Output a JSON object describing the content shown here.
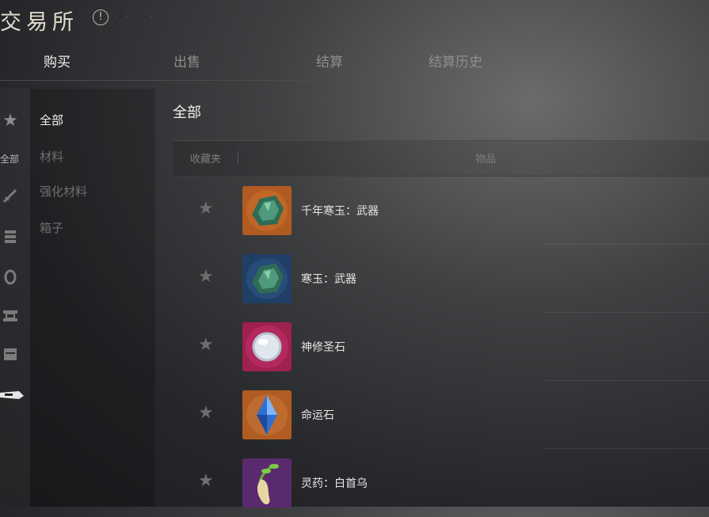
{
  "window": {
    "title": "交易所",
    "info_icon": "info-circle-icon",
    "faint_text": "· · · ·"
  },
  "tabs": [
    {
      "label": "购买",
      "active": true
    },
    {
      "label": "出售",
      "active": false
    },
    {
      "label": "结算",
      "active": false
    },
    {
      "label": "结算历史",
      "active": false
    }
  ],
  "left_rail": {
    "label": "全部",
    "icons": [
      "star-icon",
      "sword-icon",
      "armor-icon",
      "ring-icon",
      "scroll-icon",
      "chest-icon",
      "eye-mask-icon"
    ]
  },
  "categories": [
    {
      "label": "全部",
      "active": true
    },
    {
      "label": "材料",
      "active": false
    },
    {
      "label": "强化材料",
      "active": false
    },
    {
      "label": "箱子",
      "active": false
    }
  ],
  "main": {
    "heading": "全部",
    "columns": {
      "favorite": "收藏夹",
      "item": "物品"
    }
  },
  "items": [
    {
      "name": "千年寒玉：武器",
      "icon": "green-jade-icon",
      "bg": "#b15a22"
    },
    {
      "name": "寒玉：武器",
      "icon": "green-jade-icon",
      "bg": "#1f3f66"
    },
    {
      "name": "神修圣石",
      "icon": "white-orb-icon",
      "bg": "#a0204e"
    },
    {
      "name": "命运石",
      "icon": "blue-crystal-icon",
      "bg": "#b05c22"
    },
    {
      "name": "灵药：白首乌",
      "icon": "herb-root-icon",
      "bg": "#5a2a6e"
    }
  ]
}
